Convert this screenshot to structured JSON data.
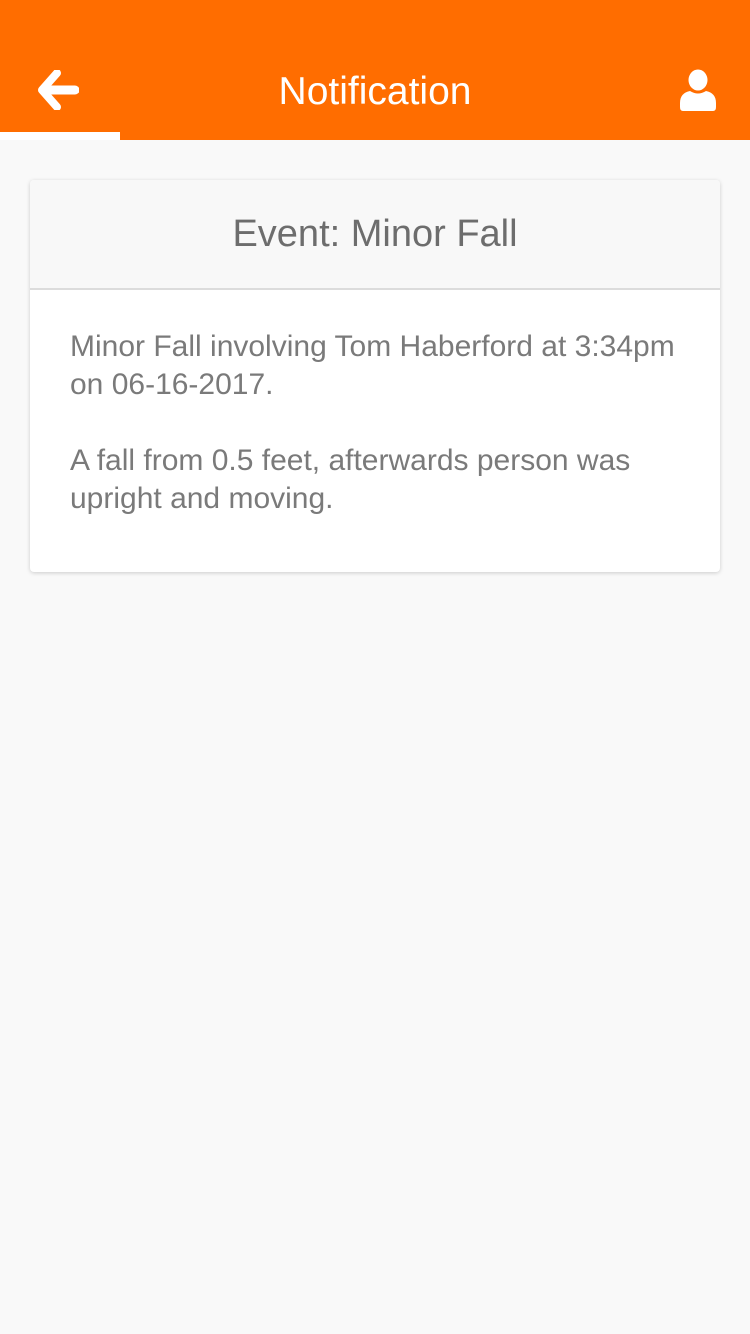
{
  "header": {
    "title": "Notification",
    "back_icon": "arrow-left-icon",
    "profile_icon": "user-icon",
    "background_color": "#ff6d00"
  },
  "event_card": {
    "title": "Event: Minor Fall",
    "paragraphs": [
      "Minor Fall involving Tom Haberford at 3:34pm on 06-16-2017.",
      "A fall from 0.5 feet, afterwards person was upright and moving."
    ]
  }
}
